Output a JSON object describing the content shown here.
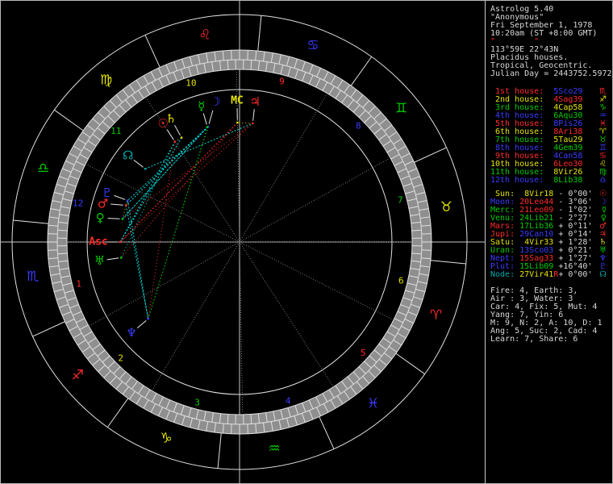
{
  "app": "Astrolog 5.40",
  "colors": {
    "red": "#ff2a2a",
    "yellow": "#e3e300",
    "green": "#00cc00",
    "blue": "#3b3bff",
    "cyan": "#00a8a8",
    "white": "#d8d8d8",
    "gray": "#7a7a7a",
    "band_fill": "#8f8f8f",
    "band_line": "#e0e0e0",
    "circle": "#e0e0e0",
    "aspect_con": "#e3e300",
    "aspect_sex": "#00d8d8",
    "aspect_squ": "#ff2a2a",
    "aspect_tri": "#00cc00",
    "aspect_opp": "#3b3bff"
  },
  "sidebar": {
    "header": {
      "lines": [
        {
          "text": "Astrolog 5.40",
          "color": "white"
        },
        {
          "text": "\"Anonymous\"",
          "color": "white"
        },
        {
          "text": "Fri September 1, 1978",
          "color": "white"
        },
        {
          "text": "10:20am (ST +8:00 GMT)",
          "color": "white"
        },
        {
          "text": "\"        \"",
          "color": "red"
        },
        {
          "text": "113°59E 22°43N",
          "color": "white"
        },
        {
          "text": "Placidus houses.",
          "color": "white"
        },
        {
          "text": "Tropical, Geocentric.",
          "color": "white"
        },
        {
          "text": "Julian Day = 2443752.5972",
          "color": "white"
        }
      ]
    },
    "houses": [
      {
        "label": " 1st house:",
        "label_color": "red",
        "value": "5Sco29",
        "value_color": "blue",
        "glyph": "♏",
        "glyph_color": "red"
      },
      {
        "label": " 2nd house:",
        "label_color": "yellow",
        "value": "4Sag39",
        "value_color": "red",
        "glyph": "♐",
        "glyph_color": "yellow"
      },
      {
        "label": " 3rd house:",
        "label_color": "green",
        "value": "4Cap58",
        "value_color": "yellow",
        "glyph": "♑",
        "glyph_color": "green"
      },
      {
        "label": " 4th house:",
        "label_color": "blue",
        "value": "6Aqu30",
        "value_color": "green",
        "glyph": "♒",
        "glyph_color": "blue"
      },
      {
        "label": " 5th house:",
        "label_color": "red",
        "value": "8Pis26",
        "value_color": "blue",
        "glyph": "♓",
        "glyph_color": "red"
      },
      {
        "label": " 6th house:",
        "label_color": "yellow",
        "value": "8Ari38",
        "value_color": "red",
        "glyph": "♈",
        "glyph_color": "yellow"
      },
      {
        "label": " 7th house:",
        "label_color": "green",
        "value": "5Tau29",
        "value_color": "yellow",
        "glyph": "♉",
        "glyph_color": "green"
      },
      {
        "label": " 8th house:",
        "label_color": "blue",
        "value": "4Gem39",
        "value_color": "green",
        "glyph": "♊",
        "glyph_color": "blue"
      },
      {
        "label": " 9th house:",
        "label_color": "red",
        "value": "4Can58",
        "value_color": "blue",
        "glyph": "♋",
        "glyph_color": "red"
      },
      {
        "label": "10th house:",
        "label_color": "yellow",
        "value": "6Leo30",
        "value_color": "red",
        "glyph": "♌",
        "glyph_color": "yellow"
      },
      {
        "label": "11th house:",
        "label_color": "green",
        "value": "8Vir26",
        "value_color": "yellow",
        "glyph": "♍",
        "glyph_color": "green"
      },
      {
        "label": "12th house:",
        "label_color": "blue",
        "value": "8Lib38",
        "value_color": "green",
        "glyph": "♎",
        "glyph_color": "blue"
      }
    ],
    "planets": [
      {
        "label": " Sun:",
        "label_color": "yellow",
        "value": " 8Vir18",
        "value_color": "yellow",
        "retro": "",
        "vel": "- 0°00'",
        "glyph": "☉",
        "glyph_color": "red"
      },
      {
        "label": "Moon:",
        "label_color": "blue",
        "value": "20Leo44",
        "value_color": "red",
        "retro": "",
        "vel": "- 3°06'",
        "glyph": "☽",
        "glyph_color": "blue"
      },
      {
        "label": "Merc:",
        "label_color": "green",
        "value": "21Leo09",
        "value_color": "red",
        "retro": "",
        "vel": "- 1°02'",
        "glyph": "☿",
        "glyph_color": "green"
      },
      {
        "label": "Venu:",
        "label_color": "green",
        "value": "24Lib21",
        "value_color": "green",
        "retro": "",
        "vel": "- 2°27'",
        "glyph": "♀",
        "glyph_color": "green"
      },
      {
        "label": "Mars:",
        "label_color": "red",
        "value": "17Lib36",
        "value_color": "green",
        "retro": "",
        "vel": "+ 0°11'",
        "glyph": "♂",
        "glyph_color": "red"
      },
      {
        "label": "Jupi:",
        "label_color": "red",
        "value": "29Can10",
        "value_color": "blue",
        "retro": "",
        "vel": "+ 0°14'",
        "glyph": "♃",
        "glyph_color": "red"
      },
      {
        "label": "Satu:",
        "label_color": "yellow",
        "value": " 4Vir33",
        "value_color": "yellow",
        "retro": "",
        "vel": "+ 1°28'",
        "glyph": "♄",
        "glyph_color": "yellow"
      },
      {
        "label": "Uran:",
        "label_color": "green",
        "value": "13Sco03",
        "value_color": "blue",
        "retro": "",
        "vel": "+ 0°21'",
        "glyph": "♅",
        "glyph_color": "green"
      },
      {
        "label": "Nept:",
        "label_color": "blue",
        "value": "15Sag33",
        "value_color": "red",
        "retro": "",
        "vel": "+ 1°27'",
        "glyph": "♆",
        "glyph_color": "blue"
      },
      {
        "label": "Plut:",
        "label_color": "blue",
        "value": "15Lib09",
        "value_color": "green",
        "retro": "",
        "vel": "+16°40'",
        "glyph": "♇",
        "glyph_color": "blue"
      },
      {
        "label": "Node:",
        "label_color": "cyan",
        "value": "27Vir41",
        "value_color": "yellow",
        "retro": "R",
        "vel": "+ 0°00'",
        "glyph": "☊",
        "glyph_color": "cyan"
      }
    ],
    "elements": [
      "Fire: 4, Earth: 3,",
      "Air : 3, Water: 3",
      "Car: 4, Fix: 5, Mut: 4",
      "Yang: 7, Yin: 6",
      "M: 9, N: 2, A: 10, D: 1",
      "Ang: 5, Suc: 2, Cad: 4",
      "Learn: 7, Share: 6"
    ]
  },
  "chart_data": {
    "type": "astrology-wheel",
    "ascendant_lon": 215.483,
    "signs": [
      {
        "name": "aries",
        "glyph": "♈",
        "element": "fire"
      },
      {
        "name": "taurus",
        "glyph": "♉",
        "element": "earth"
      },
      {
        "name": "gemini",
        "glyph": "♊",
        "element": "air"
      },
      {
        "name": "cancer",
        "glyph": "♋",
        "element": "water"
      },
      {
        "name": "leo",
        "glyph": "♌",
        "element": "fire"
      },
      {
        "name": "virgo",
        "glyph": "♍",
        "element": "earth"
      },
      {
        "name": "libra",
        "glyph": "♎",
        "element": "air"
      },
      {
        "name": "scorpio",
        "glyph": "♏",
        "element": "water"
      },
      {
        "name": "sagittarius",
        "glyph": "♐",
        "element": "fire"
      },
      {
        "name": "capricorn",
        "glyph": "♑",
        "element": "earth"
      },
      {
        "name": "aquarius",
        "glyph": "♒",
        "element": "air"
      },
      {
        "name": "pisces",
        "glyph": "♓",
        "element": "water"
      }
    ],
    "house_cusps": [
      215.483,
      244.65,
      274.967,
      306.5,
      338.433,
      8.633,
      35.483,
      64.65,
      94.967,
      126.5,
      158.433,
      188.633
    ],
    "house_number_colors": [
      "red",
      "yellow",
      "green",
      "blue",
      "red",
      "yellow",
      "green",
      "blue",
      "red",
      "yellow",
      "green",
      "blue"
    ],
    "planets": [
      {
        "name": "Sun",
        "glyph": "☉",
        "lon": 158.3,
        "color": "red"
      },
      {
        "name": "Moon",
        "glyph": "☽",
        "lon": 140.733,
        "color": "blue"
      },
      {
        "name": "Merc",
        "glyph": "☿",
        "lon": 141.15,
        "color": "green"
      },
      {
        "name": "Venu",
        "glyph": "♀",
        "lon": 204.35,
        "color": "green"
      },
      {
        "name": "Mars",
        "glyph": "♂",
        "lon": 197.6,
        "color": "red"
      },
      {
        "name": "Jupi",
        "glyph": "♃",
        "lon": 119.167,
        "color": "red"
      },
      {
        "name": "Satu",
        "glyph": "♄",
        "lon": 154.55,
        "color": "yellow"
      },
      {
        "name": "Uran",
        "glyph": "♅",
        "lon": 223.05,
        "color": "green"
      },
      {
        "name": "Nept",
        "glyph": "♆",
        "lon": 255.55,
        "color": "blue"
      },
      {
        "name": "Plut",
        "glyph": "♇",
        "lon": 195.15,
        "color": "blue"
      },
      {
        "name": "Node",
        "glyph": "☊",
        "lon": 177.683,
        "color": "cyan"
      },
      {
        "name": "MC",
        "glyph": "MC",
        "lon": 126.5,
        "color": "yellow",
        "is_text": true
      },
      {
        "name": "Asc",
        "glyph": "Asc",
        "lon": 215.483,
        "color": "red",
        "is_text": true
      }
    ],
    "aspects": [
      [
        "Sun",
        "Satu",
        "con"
      ],
      [
        "Moon",
        "Merc",
        "con"
      ],
      [
        "Venu",
        "Mars",
        "con"
      ],
      [
        "Mars",
        "Plut",
        "con"
      ],
      [
        "Jupi",
        "MC",
        "con"
      ],
      [
        "Sun",
        "Nept",
        "squ"
      ],
      [
        "Venu",
        "Jupi",
        "squ"
      ],
      [
        "Asc",
        "Jupi",
        "squ"
      ],
      [
        "MC",
        "Uran",
        "squ"
      ],
      [
        "MC",
        "Asc",
        "squ"
      ],
      [
        "Moon",
        "Nept",
        "tri"
      ],
      [
        "Merc",
        "Nept",
        "tri"
      ],
      [
        "Moon",
        "Mars",
        "sex"
      ],
      [
        "Moon",
        "Venu",
        "sex"
      ],
      [
        "Moon",
        "Plut",
        "sex"
      ],
      [
        "Merc",
        "Mars",
        "sex"
      ],
      [
        "Merc",
        "Venu",
        "sex"
      ],
      [
        "Merc",
        "Plut",
        "sex"
      ],
      [
        "Plut",
        "Nept",
        "sex"
      ],
      [
        "Mars",
        "Nept",
        "sex"
      ],
      [
        "Sun",
        "Asc",
        "sex"
      ],
      [
        "Sun",
        "Uran",
        "sex"
      ],
      [
        "Satu",
        "Asc",
        "sex"
      ],
      [
        "Node",
        "Jupi",
        "sex"
      ]
    ]
  }
}
